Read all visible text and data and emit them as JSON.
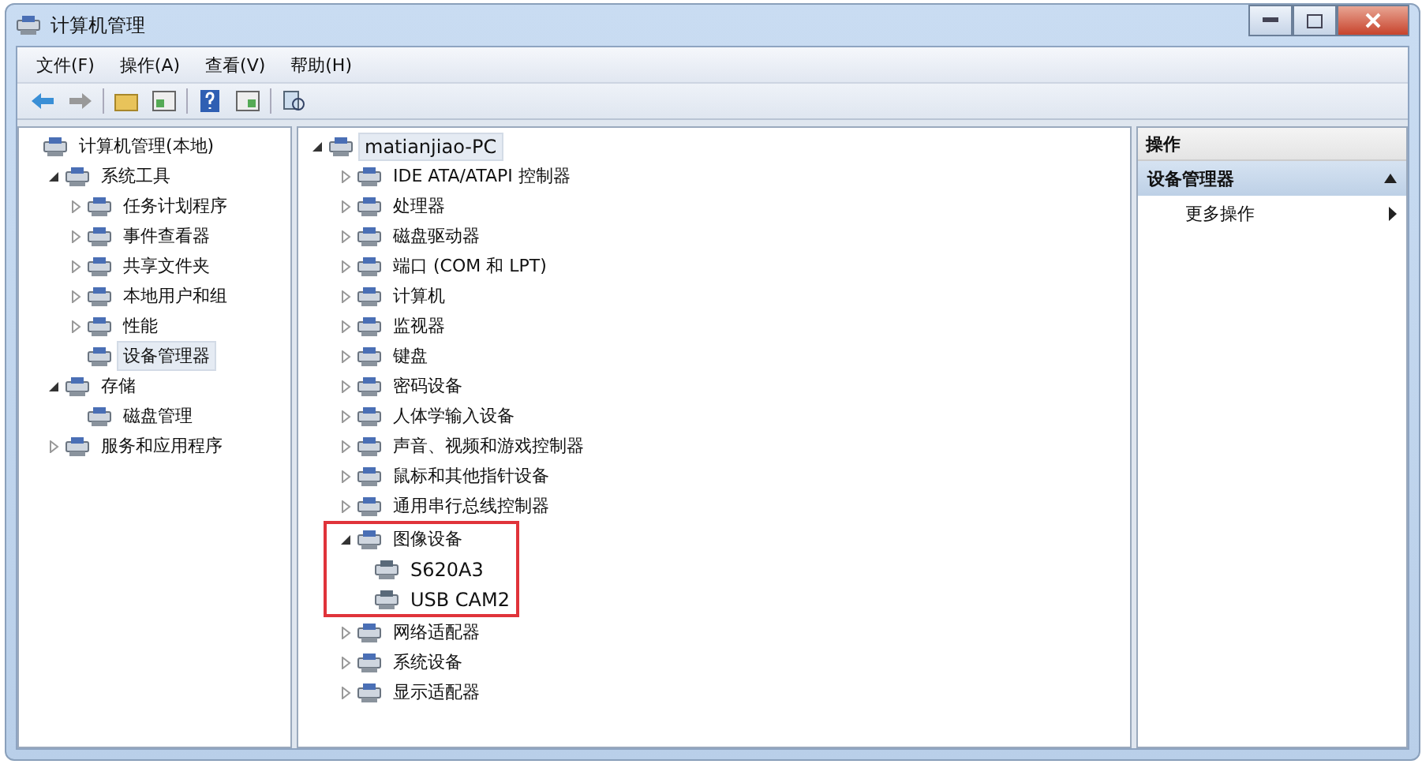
{
  "window": {
    "title": "计算机管理"
  },
  "menu": [
    "文件(F)",
    "操作(A)",
    "查看(V)",
    "帮助(H)"
  ],
  "nav_tree": [
    {
      "label": "计算机管理(本地)",
      "selected": false,
      "children": [
        {
          "label": "系统工具",
          "expanded": true,
          "selected": false,
          "children": [
            {
              "label": "任务计划程序",
              "expanded": false,
              "selected": false
            },
            {
              "label": "事件查看器",
              "expanded": false,
              "selected": false
            },
            {
              "label": "共享文件夹",
              "expanded": false,
              "selected": false
            },
            {
              "label": "本地用户和组",
              "expanded": false,
              "selected": false
            },
            {
              "label": "性能",
              "expanded": false,
              "selected": false
            },
            {
              "label": "设备管理器",
              "selected": true
            }
          ]
        },
        {
          "label": "存储",
          "expanded": true,
          "selected": false,
          "children": [
            {
              "label": "磁盘管理",
              "selected": false
            }
          ]
        },
        {
          "label": "服务和应用程序",
          "expanded": false,
          "selected": false
        }
      ]
    }
  ],
  "device_tree": {
    "label": "matianjiao-PC",
    "expanded": true,
    "selected": true,
    "children": [
      {
        "label": "IDE ATA/ATAPI 控制器",
        "expanded": false,
        "highlighted": false
      },
      {
        "label": "处理器",
        "expanded": false,
        "highlighted": false
      },
      {
        "label": "磁盘驱动器",
        "expanded": false,
        "highlighted": false
      },
      {
        "label": "端口 (COM 和 LPT)",
        "expanded": false,
        "highlighted": false
      },
      {
        "label": "计算机",
        "expanded": false,
        "highlighted": false
      },
      {
        "label": "监视器",
        "expanded": false,
        "highlighted": false
      },
      {
        "label": "键盘",
        "expanded": false,
        "highlighted": false
      },
      {
        "label": "密码设备",
        "expanded": false,
        "highlighted": false
      },
      {
        "label": "人体学输入设备",
        "expanded": false,
        "highlighted": false
      },
      {
        "label": "声音、视频和游戏控制器",
        "expanded": false,
        "highlighted": false
      },
      {
        "label": "鼠标和其他指针设备",
        "expanded": false,
        "highlighted": false
      },
      {
        "label": "通用串行总线控制器",
        "expanded": false,
        "highlighted": false
      },
      {
        "label": "图像设备",
        "expanded": true,
        "highlighted": true,
        "children": [
          "S620A3",
          "USB CAM2"
        ]
      },
      {
        "label": "网络适配器",
        "expanded": false,
        "highlighted": false
      },
      {
        "label": "系统设备",
        "expanded": false,
        "highlighted": false
      },
      {
        "label": "显示适配器",
        "expanded": false,
        "highlighted": false
      }
    ]
  },
  "actions": {
    "header": "操作",
    "section": "设备管理器",
    "items": [
      "更多操作"
    ]
  }
}
